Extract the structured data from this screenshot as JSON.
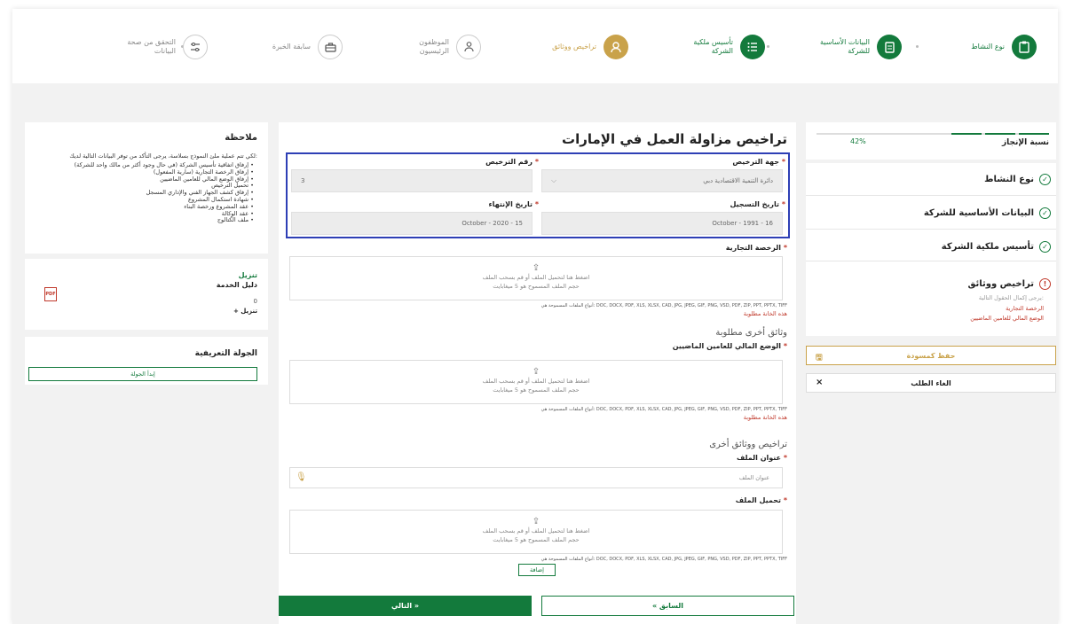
{
  "stepper": {
    "steps": [
      {
        "label": "نوع النشاط",
        "state": "done",
        "icon": "clipboard-icon"
      },
      {
        "label": "البيانات الأساسية للشركة",
        "state": "done",
        "icon": "document-icon"
      },
      {
        "label": "تأسيس ملكية الشركة",
        "state": "done",
        "icon": "list-icon"
      },
      {
        "label": "تراخيص ووثائق",
        "state": "active",
        "icon": "user-key-icon"
      },
      {
        "label": "الموظفون الرئيسيون",
        "state": "todo",
        "icon": "people-icon"
      },
      {
        "label": "سابقة الخبرة",
        "state": "todo",
        "icon": "briefcase-icon"
      },
      {
        "label": "التحقق من صحة البيانات",
        "state": "todo",
        "icon": "sliders-icon"
      }
    ]
  },
  "sidebar": {
    "progress_label": "نسبة الإنجاز",
    "progress_percent": "42%",
    "progress_value": 0.42,
    "nav": [
      {
        "label": "نوع النشاط",
        "state": "done"
      },
      {
        "label": "البيانات الأساسية للشركة",
        "state": "done"
      },
      {
        "label": "تأسيس ملكية الشركة",
        "state": "done"
      },
      {
        "label": "تراخيص ووثائق",
        "state": "error"
      }
    ],
    "nav_sub": "يرجى إكمال الحقول التالية:",
    "nav_errors": [
      "الرخصة التجارية",
      "الوضع المالي للعامين الماضيين"
    ],
    "save_draft": "حفظ كمسودة",
    "cancel_request": "الغاء الطلب",
    "accent": "#137a3c",
    "gold": "#c9a24a"
  },
  "main": {
    "title": "تراخيص مزاولة العمل في الإمارات",
    "license_authority_label": "جهة الترخيص",
    "license_authority_value": "دائرة التنمية الاقتصادية دبي",
    "license_number_label": "رقم الترخيص",
    "license_number_value": "3",
    "registration_date_label": "تاريخ التسجيل",
    "registration_date_value": "October - 1991 - 16",
    "expiry_date_label": "تاريخ الإنتهاء",
    "expiry_date_value": "October - 2020 - 15",
    "trade_license_label": "الرخصة التجارية",
    "upload_hint": "اضغط هنا لتحميل الملف أو قم بسحب الملف",
    "upload_size": "حجم الملف المسموح هو 5 ميغابايت",
    "allowed_types": "أنواع الملفات المسموحة هي: DOC, DOCX, PDF, XLS, XLSX, CAD, JPG, JPEG, GIF, PNG, VSD, PDF, ZIP, PPT, PPTX, TIFF",
    "required_msg": "هذه الخانة مطلوبة",
    "other_docs_title": "وثائق أخرى مطلوبة",
    "financial_label": "الوضع المالي للعامين الماضيين",
    "other_licenses_title": "تراخيص ووثائق أخرى",
    "file_title_label": "عنوان الملف",
    "file_title_placeholder": "عنوان الملف",
    "file_upload_label": "تحميل الملف",
    "add_button": "إضافة",
    "next_button": "التالي »",
    "prev_button": "« السابق"
  },
  "left": {
    "note_title": "ملاحظة",
    "note_intro": "لكي تتم عملية ملئ النموذج بسلاسة، يرجى التأكد من توفر البيانات التالية لديك:",
    "note_items": [
      "إرفاق اتفاقية تأسيس الشركة (في حال وجود أكثر من مالك واحد للشركة)",
      "إرفاق الرخصة التجارية (سارية المفعول)",
      "إرفاق الوضع المالي للعامين الماضيين",
      "تحميل الترخيص",
      "إرفاق كشف الجهاز الفني والإداري المسجل",
      "شهادة استكمال المشروع",
      "عقد المشروع ورخصة البناء",
      "عقد الوكالة",
      "ملف الكتالوج"
    ],
    "download_title": "تنزيل",
    "download_name": "دليل الخدمة",
    "download_count": "0",
    "download_link": "+ تنزيل",
    "pdf_badge": "PDF",
    "tour_title": "الجولة التعريفية",
    "tour_button": "إبدأ الجولة"
  }
}
